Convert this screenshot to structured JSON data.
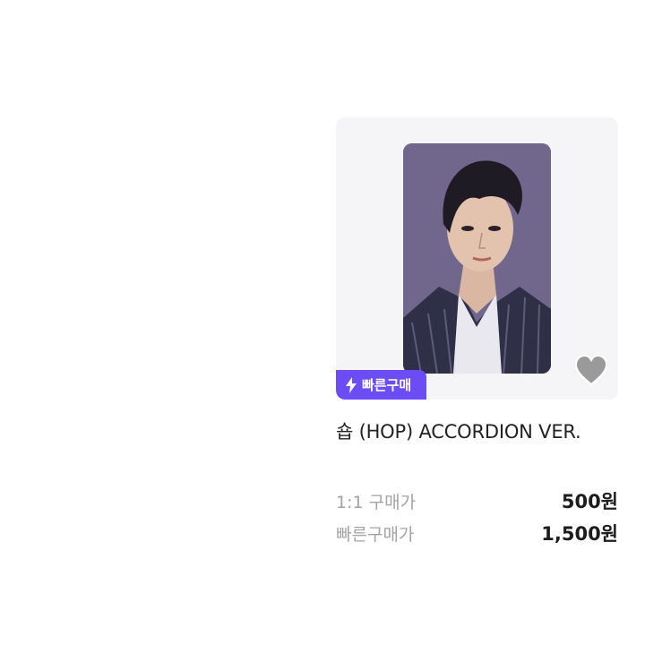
{
  "product": {
    "badge_label": "빠른구매",
    "title": "숍 (HOP) ACCORDION VER.",
    "like_icon": "heart-icon",
    "badge_icon": "lightning-bolt-icon",
    "prices": [
      {
        "label": "1:1 구매가",
        "value": "500원"
      },
      {
        "label": "빠른구매가",
        "value": "1,500원"
      }
    ]
  },
  "colors": {
    "badge_background": "#6c4cf5",
    "card_background": "#f5f5f7",
    "heart": "#9a9a9a",
    "price_label": "#a3a3a3",
    "price_value": "#1d1d1d"
  }
}
